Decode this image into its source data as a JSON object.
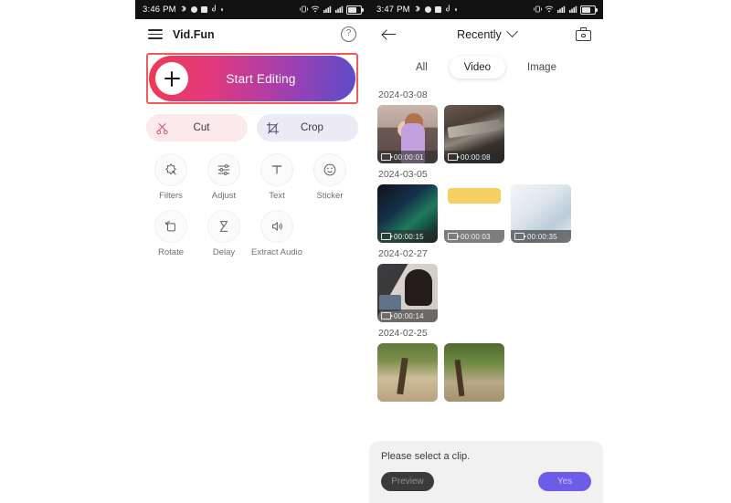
{
  "left_phone": {
    "status_bar": {
      "time": "3:46 PM",
      "icons": [
        "bluetooth-icon",
        "record-icon",
        "screenshot-icon",
        "tiktok-icon",
        "dot-icon"
      ],
      "right_icons": [
        "vibrate-icon",
        "wifi-icon",
        "signal-4g-1-icon",
        "signal-4g-2-icon",
        "battery-icon"
      ]
    },
    "appbar": {
      "menu_icon": "hamburger-icon",
      "title": "Vid.Fun",
      "help_icon": "?"
    },
    "start_editing": {
      "label": "Start Editing",
      "plus_icon": "+",
      "highlight_color": "#f25a5a",
      "gradient_from": "#ef3a54",
      "gradient_to": "#5c4cc8"
    },
    "quick_actions": [
      {
        "label": "Cut",
        "icon": "scissors-icon",
        "bg": "#fbe9ec"
      },
      {
        "label": "Crop",
        "icon": "crop-icon",
        "bg": "#eceaf6"
      }
    ],
    "tools_row1": [
      {
        "label": "Filters",
        "icon": "magic-wand-icon"
      },
      {
        "label": "Adjust",
        "icon": "sliders-icon"
      },
      {
        "label": "Text",
        "icon": "text-icon"
      },
      {
        "label": "Sticker",
        "icon": "smiley-icon"
      }
    ],
    "tools_row2": [
      {
        "label": "Rotate",
        "icon": "rotate-icon"
      },
      {
        "label": "Delay",
        "icon": "hourglass-icon"
      },
      {
        "label": "Extract Audio",
        "icon": "speaker-icon"
      }
    ]
  },
  "right_phone": {
    "status_bar": {
      "time": "3:47 PM"
    },
    "gallery_bar": {
      "back_icon": "back-arrow-icon",
      "title": "Recently",
      "chevron_icon": "chevron-down-icon",
      "camera_icon": "camera-icon"
    },
    "tabs": [
      {
        "label": "All",
        "active": false
      },
      {
        "label": "Video",
        "active": true
      },
      {
        "label": "Image",
        "active": false
      }
    ],
    "groups": [
      {
        "date": "2024-03-08",
        "items": [
          {
            "duration": "00:00:01",
            "art": "a-girl"
          },
          {
            "duration": "00:00:08",
            "art": "a-metal"
          }
        ]
      },
      {
        "date": "2024-03-05",
        "items": [
          {
            "duration": "00:00:15",
            "art": "a-home1"
          },
          {
            "duration": "00:00:03",
            "art": "a-white"
          },
          {
            "duration": "00:00:35",
            "art": "a-home2"
          }
        ]
      },
      {
        "date": "2024-02-27",
        "items": [
          {
            "duration": "00:00:14",
            "art": "a-person"
          }
        ]
      },
      {
        "date": "2024-02-25",
        "items": [
          {
            "duration": "",
            "art": "a-tree1"
          },
          {
            "duration": "",
            "art": "a-tree2"
          }
        ]
      }
    ],
    "bottom_sheet": {
      "message": "Please select a clip.",
      "preview_label": "Preview",
      "confirm_label": "Yes",
      "confirm_color": "#6c5ce7"
    }
  }
}
